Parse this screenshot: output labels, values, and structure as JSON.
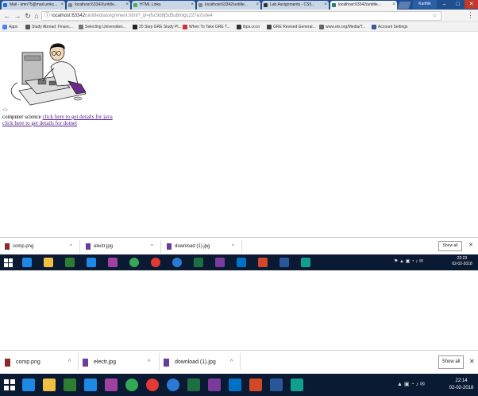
{
  "browser": {
    "tabs": [
      {
        "label": "Mail - kmn75@mail.umkc...",
        "favicon_color": "#1e6fd0"
      },
      {
        "label": "localhost:63342/untitle...",
        "favicon_color": "#888888"
      },
      {
        "label": "HTML Links",
        "favicon_color": "#4caf50"
      },
      {
        "label": "localhost:63342/untitle...",
        "favicon_color": "#888888"
      },
      {
        "label": "Lab Assignments - CS5...",
        "favicon_color": "#333333"
      },
      {
        "label": "localhost:63342/untitle...",
        "favicon_color": "#2b7a78"
      }
    ],
    "profile_name": "Karthik",
    "url_host": "localhost:63342",
    "url_path": "/untitled/assignment.html?_ijt=jfsc9d8j5d5u8mlgc227a7u0e4",
    "bookmarks": [
      {
        "label": "Apps",
        "icon_color": "#4285f4"
      },
      {
        "label": "Study Abroad: Financ...",
        "icon_color": "#555555"
      },
      {
        "label": "Selecting Universities...",
        "icon_color": "#777777"
      },
      {
        "label": "20 Step GRE Study Pl...",
        "icon_color": "#222222"
      },
      {
        "label": "When To Take GRE T...",
        "icon_color": "#cc3333"
      },
      {
        "label": "ibps.co.in",
        "icon_color": "#333333"
      },
      {
        "label": "GRE Revised General...",
        "icon_color": "#444444"
      },
      {
        "label": "www.ets.org/Media/T...",
        "icon_color": "#666666"
      },
      {
        "label": "Account Settings",
        "icon_color": "#3b5998"
      }
    ]
  },
  "page": {
    "alt_text": "<>",
    "prefix_text": "computer science",
    "link_java": "click here to get details for java",
    "link_dotnet": "click here to get details for dotnet"
  },
  "downloads": {
    "items": [
      {
        "label": "comp.png"
      },
      {
        "label": "electr.jpg"
      },
      {
        "label": "download (1).jpg"
      }
    ],
    "show_all_label": "Show all",
    "close_symbol": "✕",
    "chevron_symbol": "^"
  },
  "taskbar": {
    "icons": [
      {
        "name": "edge-icon",
        "color": "#1e88e5"
      },
      {
        "name": "file-explorer-icon",
        "color": "#f0c040"
      },
      {
        "name": "store-icon",
        "color": "#2e7d32"
      },
      {
        "name": "dropbox-icon",
        "color": "#1e88e5"
      },
      {
        "name": "photos-icon",
        "color": "#a040a0"
      },
      {
        "name": "chrome-icon",
        "color": "#34a853"
      },
      {
        "name": "opera-icon",
        "color": "#e53935"
      },
      {
        "name": "sync-icon",
        "color": "#2a7ad5"
      },
      {
        "name": "excel-icon",
        "color": "#1d6f42"
      },
      {
        "name": "onenote-icon",
        "color": "#7a3b9d"
      },
      {
        "name": "outlook-icon",
        "color": "#0072c6"
      },
      {
        "name": "powerpoint-icon",
        "color": "#d24726"
      },
      {
        "name": "word-icon",
        "color": "#2b579a"
      },
      {
        "name": "webstorm-icon",
        "color": "#10a090"
      }
    ],
    "time_top": "22:23",
    "date_top": "02-02-2018",
    "time_bottom": "22:14",
    "date_bottom": "02-02-2018"
  }
}
